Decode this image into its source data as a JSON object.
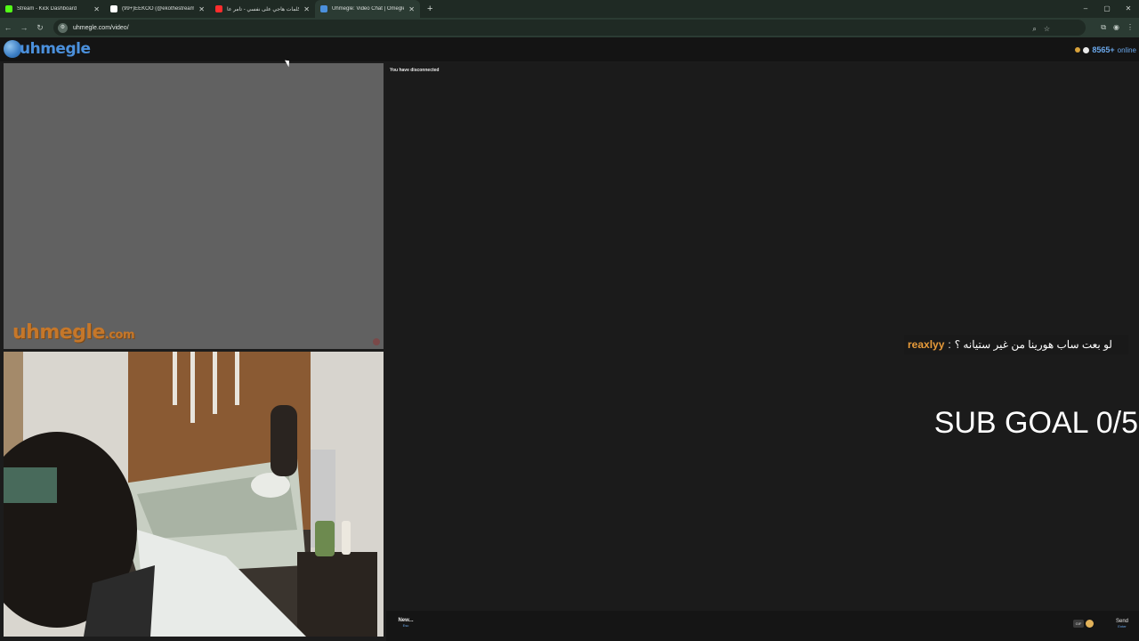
{
  "browser": {
    "tabs": [
      {
        "title": "Stream - Kick Dashboard",
        "favicon_color": "#53fc18",
        "active": false
      },
      {
        "title": "(99+)EEKOO (@ekothestreamer)",
        "favicon_color": "#ffffff",
        "active": false
      },
      {
        "title": "كلمات هاجي على نفسي - تامر عا...",
        "favicon_color": "#ff2d2d",
        "active": false
      },
      {
        "title": "Uhmegle: Video Chat | Omegle",
        "favicon_color": "#4b90dc",
        "active": true
      }
    ],
    "new_tab_icon": "plus-icon",
    "url": "uhmegle.com/video/",
    "controls": {
      "minimize": "–",
      "maximize": "▢",
      "close": "✕"
    }
  },
  "site": {
    "logo_text": "uhmegle",
    "online_count": "8565+",
    "online_label": "online",
    "watermark_text": "uhmegle",
    "watermark_suffix": ".com"
  },
  "chat": {
    "status_message": "You have disconnected",
    "new_button": "New...",
    "new_key": "Esc",
    "gif_label": "GIF",
    "send_button": "Send",
    "send_key": "Enter"
  },
  "stream_overlay": {
    "chat_user": "reaxlyy",
    "chat_separator": ":",
    "chat_message": "لو بعت ساب هورينا من غير ستيانه ؟",
    "sub_goal": "SUB GOAL 0/5"
  },
  "colors": {
    "accent": "#4b90dc",
    "watermark": "#c5772a",
    "username": "#e89b3a"
  }
}
